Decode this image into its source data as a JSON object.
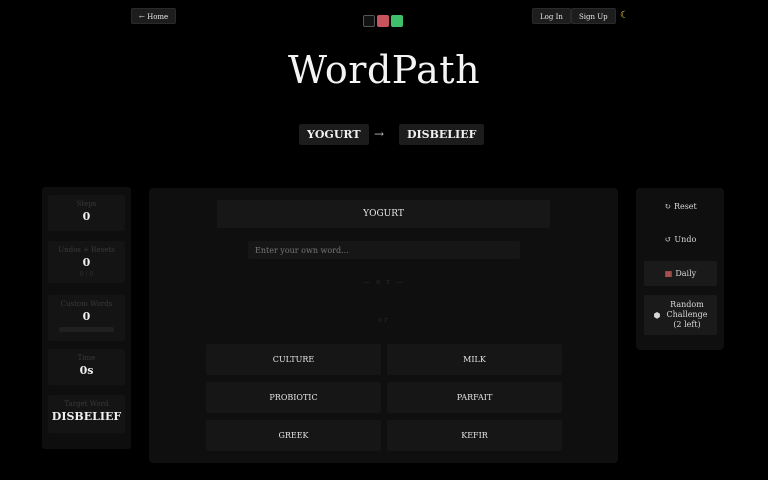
{
  "header": {
    "home_label": "← Home",
    "login_label": "Log In",
    "signup_label": "Sign Up",
    "theme_icon": "moon-icon",
    "swatches": [
      "#111111",
      "#c7545c",
      "#3fbf6a"
    ]
  },
  "title": "WordPath",
  "path": {
    "start_word": "YOGURT",
    "arrow": "→",
    "target_word": "DISBELIEF"
  },
  "stats": {
    "steps_label": "Steps",
    "steps_value": "0",
    "undos_label": "Undos + Resets",
    "undos_value": "0",
    "undos_sub": "0 / 0",
    "custom_label": "Custom Words",
    "custom_value": "0",
    "time_label": "Time",
    "time_value": "0s",
    "target_label": "Target Word",
    "target_value": "DISBELIEF"
  },
  "main": {
    "current_word": "YOGURT",
    "input_placeholder": "Enter your own word...",
    "hint_faint_1": "— o r —",
    "hint_faint_2": "or",
    "options": [
      "CULTURE",
      "MILK",
      "PROBIOTIC",
      "PARFAIT",
      "GREEK",
      "KEFIR"
    ]
  },
  "actions": {
    "reset_label": "Reset",
    "undo_label": "Undo",
    "daily_label": "Daily",
    "random_label_1": "Random",
    "random_label_2": "Challenge",
    "random_label_3": "(2 left)"
  }
}
